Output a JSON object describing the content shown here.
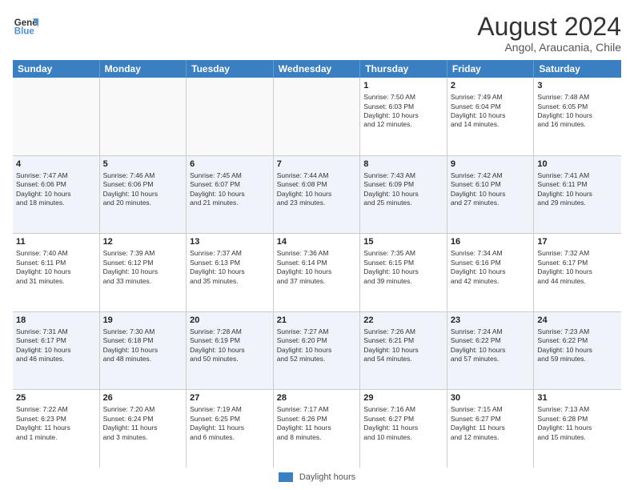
{
  "header": {
    "logo_line1": "General",
    "logo_line2": "Blue",
    "title": "August 2024",
    "subtitle": "Angol, Araucania, Chile"
  },
  "days_of_week": [
    "Sunday",
    "Monday",
    "Tuesday",
    "Wednesday",
    "Thursday",
    "Friday",
    "Saturday"
  ],
  "rows": [
    {
      "alt": false,
      "cells": [
        {
          "day": "",
          "lines": []
        },
        {
          "day": "",
          "lines": []
        },
        {
          "day": "",
          "lines": []
        },
        {
          "day": "",
          "lines": []
        },
        {
          "day": "1",
          "lines": [
            "Sunrise: 7:50 AM",
            "Sunset: 6:03 PM",
            "Daylight: 10 hours",
            "and 12 minutes."
          ]
        },
        {
          "day": "2",
          "lines": [
            "Sunrise: 7:49 AM",
            "Sunset: 6:04 PM",
            "Daylight: 10 hours",
            "and 14 minutes."
          ]
        },
        {
          "day": "3",
          "lines": [
            "Sunrise: 7:48 AM",
            "Sunset: 6:05 PM",
            "Daylight: 10 hours",
            "and 16 minutes."
          ]
        }
      ]
    },
    {
      "alt": true,
      "cells": [
        {
          "day": "4",
          "lines": [
            "Sunrise: 7:47 AM",
            "Sunset: 6:06 PM",
            "Daylight: 10 hours",
            "and 18 minutes."
          ]
        },
        {
          "day": "5",
          "lines": [
            "Sunrise: 7:46 AM",
            "Sunset: 6:06 PM",
            "Daylight: 10 hours",
            "and 20 minutes."
          ]
        },
        {
          "day": "6",
          "lines": [
            "Sunrise: 7:45 AM",
            "Sunset: 6:07 PM",
            "Daylight: 10 hours",
            "and 21 minutes."
          ]
        },
        {
          "day": "7",
          "lines": [
            "Sunrise: 7:44 AM",
            "Sunset: 6:08 PM",
            "Daylight: 10 hours",
            "and 23 minutes."
          ]
        },
        {
          "day": "8",
          "lines": [
            "Sunrise: 7:43 AM",
            "Sunset: 6:09 PM",
            "Daylight: 10 hours",
            "and 25 minutes."
          ]
        },
        {
          "day": "9",
          "lines": [
            "Sunrise: 7:42 AM",
            "Sunset: 6:10 PM",
            "Daylight: 10 hours",
            "and 27 minutes."
          ]
        },
        {
          "day": "10",
          "lines": [
            "Sunrise: 7:41 AM",
            "Sunset: 6:11 PM",
            "Daylight: 10 hours",
            "and 29 minutes."
          ]
        }
      ]
    },
    {
      "alt": false,
      "cells": [
        {
          "day": "11",
          "lines": [
            "Sunrise: 7:40 AM",
            "Sunset: 6:11 PM",
            "Daylight: 10 hours",
            "and 31 minutes."
          ]
        },
        {
          "day": "12",
          "lines": [
            "Sunrise: 7:39 AM",
            "Sunset: 6:12 PM",
            "Daylight: 10 hours",
            "and 33 minutes."
          ]
        },
        {
          "day": "13",
          "lines": [
            "Sunrise: 7:37 AM",
            "Sunset: 6:13 PM",
            "Daylight: 10 hours",
            "and 35 minutes."
          ]
        },
        {
          "day": "14",
          "lines": [
            "Sunrise: 7:36 AM",
            "Sunset: 6:14 PM",
            "Daylight: 10 hours",
            "and 37 minutes."
          ]
        },
        {
          "day": "15",
          "lines": [
            "Sunrise: 7:35 AM",
            "Sunset: 6:15 PM",
            "Daylight: 10 hours",
            "and 39 minutes."
          ]
        },
        {
          "day": "16",
          "lines": [
            "Sunrise: 7:34 AM",
            "Sunset: 6:16 PM",
            "Daylight: 10 hours",
            "and 42 minutes."
          ]
        },
        {
          "day": "17",
          "lines": [
            "Sunrise: 7:32 AM",
            "Sunset: 6:17 PM",
            "Daylight: 10 hours",
            "and 44 minutes."
          ]
        }
      ]
    },
    {
      "alt": true,
      "cells": [
        {
          "day": "18",
          "lines": [
            "Sunrise: 7:31 AM",
            "Sunset: 6:17 PM",
            "Daylight: 10 hours",
            "and 46 minutes."
          ]
        },
        {
          "day": "19",
          "lines": [
            "Sunrise: 7:30 AM",
            "Sunset: 6:18 PM",
            "Daylight: 10 hours",
            "and 48 minutes."
          ]
        },
        {
          "day": "20",
          "lines": [
            "Sunrise: 7:28 AM",
            "Sunset: 6:19 PM",
            "Daylight: 10 hours",
            "and 50 minutes."
          ]
        },
        {
          "day": "21",
          "lines": [
            "Sunrise: 7:27 AM",
            "Sunset: 6:20 PM",
            "Daylight: 10 hours",
            "and 52 minutes."
          ]
        },
        {
          "day": "22",
          "lines": [
            "Sunrise: 7:26 AM",
            "Sunset: 6:21 PM",
            "Daylight: 10 hours",
            "and 54 minutes."
          ]
        },
        {
          "day": "23",
          "lines": [
            "Sunrise: 7:24 AM",
            "Sunset: 6:22 PM",
            "Daylight: 10 hours",
            "and 57 minutes."
          ]
        },
        {
          "day": "24",
          "lines": [
            "Sunrise: 7:23 AM",
            "Sunset: 6:22 PM",
            "Daylight: 10 hours",
            "and 59 minutes."
          ]
        }
      ]
    },
    {
      "alt": false,
      "cells": [
        {
          "day": "25",
          "lines": [
            "Sunrise: 7:22 AM",
            "Sunset: 6:23 PM",
            "Daylight: 11 hours",
            "and 1 minute."
          ]
        },
        {
          "day": "26",
          "lines": [
            "Sunrise: 7:20 AM",
            "Sunset: 6:24 PM",
            "Daylight: 11 hours",
            "and 3 minutes."
          ]
        },
        {
          "day": "27",
          "lines": [
            "Sunrise: 7:19 AM",
            "Sunset: 6:25 PM",
            "Daylight: 11 hours",
            "and 6 minutes."
          ]
        },
        {
          "day": "28",
          "lines": [
            "Sunrise: 7:17 AM",
            "Sunset: 6:26 PM",
            "Daylight: 11 hours",
            "and 8 minutes."
          ]
        },
        {
          "day": "29",
          "lines": [
            "Sunrise: 7:16 AM",
            "Sunset: 6:27 PM",
            "Daylight: 11 hours",
            "and 10 minutes."
          ]
        },
        {
          "day": "30",
          "lines": [
            "Sunrise: 7:15 AM",
            "Sunset: 6:27 PM",
            "Daylight: 11 hours",
            "and 12 minutes."
          ]
        },
        {
          "day": "31",
          "lines": [
            "Sunrise: 7:13 AM",
            "Sunset: 6:28 PM",
            "Daylight: 11 hours",
            "and 15 minutes."
          ]
        }
      ]
    }
  ],
  "footer": {
    "legend_label": "Daylight hours"
  }
}
